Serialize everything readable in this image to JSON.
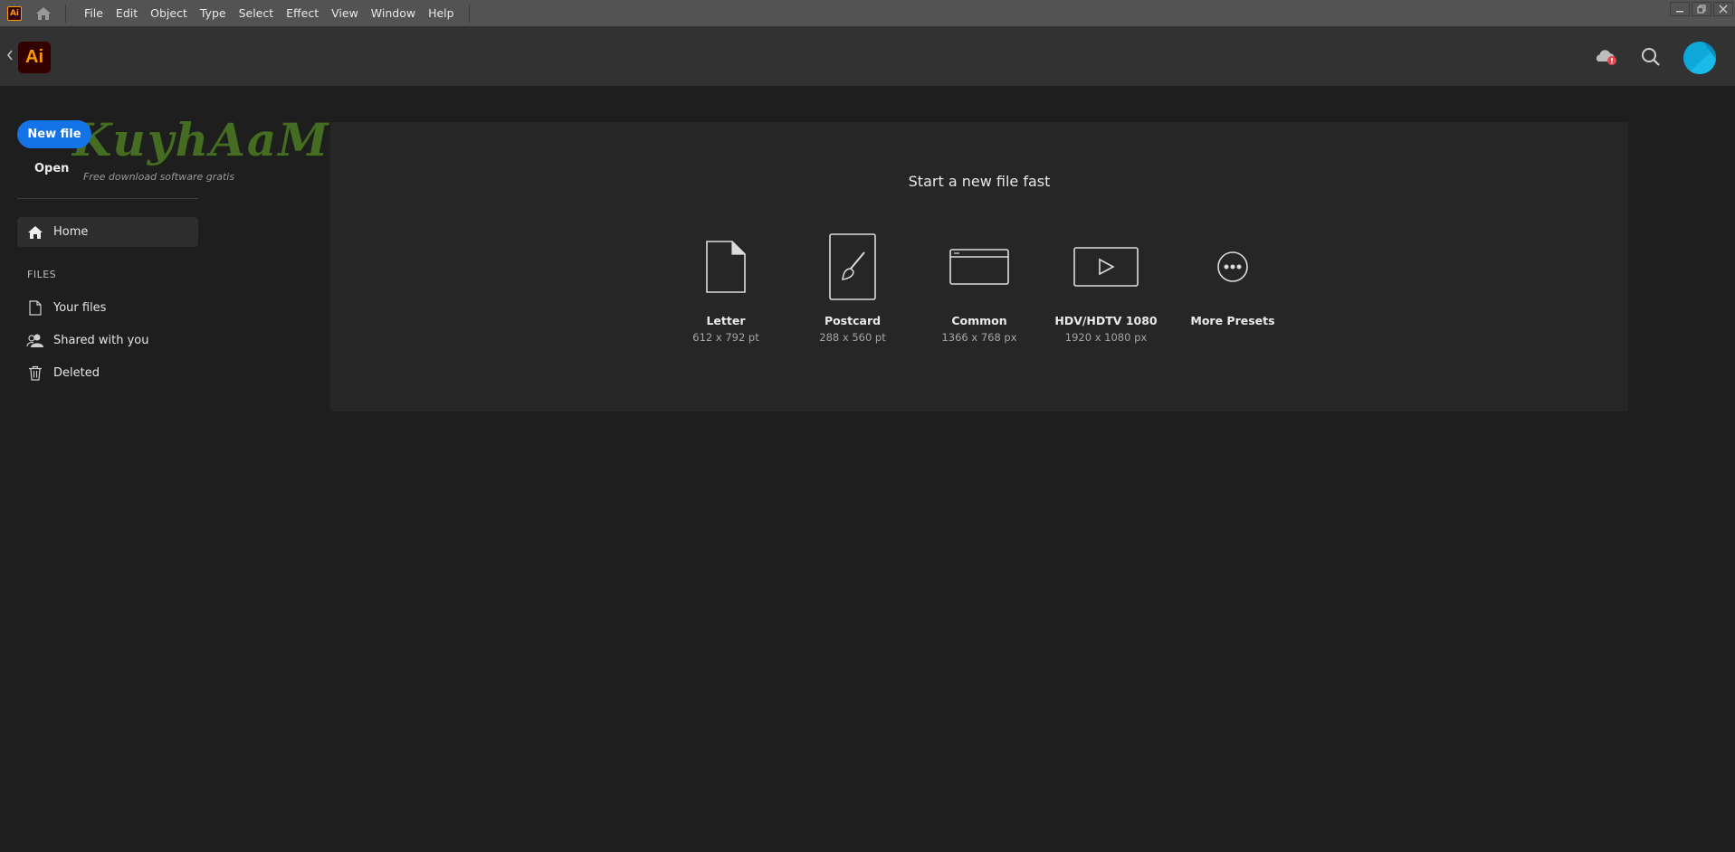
{
  "menubar": {
    "app_badge": "Ai",
    "items": [
      "File",
      "Edit",
      "Object",
      "Type",
      "Select",
      "Effect",
      "View",
      "Window",
      "Help"
    ]
  },
  "header": {
    "logo": "Ai",
    "icons": {
      "back": "chevron-left-icon",
      "cloud": "cloud-sync-icon",
      "search": "search-icon",
      "avatar": "avatar"
    }
  },
  "sidebar": {
    "new_file": "New file",
    "open": "Open",
    "watermark": {
      "title": "KuyhAaMe",
      "subtitle": "Free download software gratis"
    },
    "home": "Home",
    "files_heading": "FILES",
    "files": [
      {
        "label": "Your files",
        "icon": "document-icon"
      },
      {
        "label": "Shared with you",
        "icon": "shared-users-icon"
      },
      {
        "label": "Deleted",
        "icon": "trash-icon"
      }
    ]
  },
  "main": {
    "quickstart_title": "Start a new file fast",
    "presets": [
      {
        "name": "Letter",
        "size": "612 x 792 pt",
        "icon": "document-icon"
      },
      {
        "name": "Postcard",
        "size": "288 x 560 pt",
        "icon": "brush-icon"
      },
      {
        "name": "Common",
        "size": "1366 x 768 px",
        "icon": "browser-window-icon"
      },
      {
        "name": "HDV/HDTV 1080",
        "size": "1920 x 1080 px",
        "icon": "video-play-icon"
      },
      {
        "name": "More Presets",
        "size": "",
        "icon": "more-ellipsis-icon"
      }
    ]
  },
  "colors": {
    "accent": "#1473e6",
    "brand": "#ff9a00",
    "brand_bg": "#330000",
    "avatar": "#0ea9d8",
    "notification": "#e34850"
  }
}
